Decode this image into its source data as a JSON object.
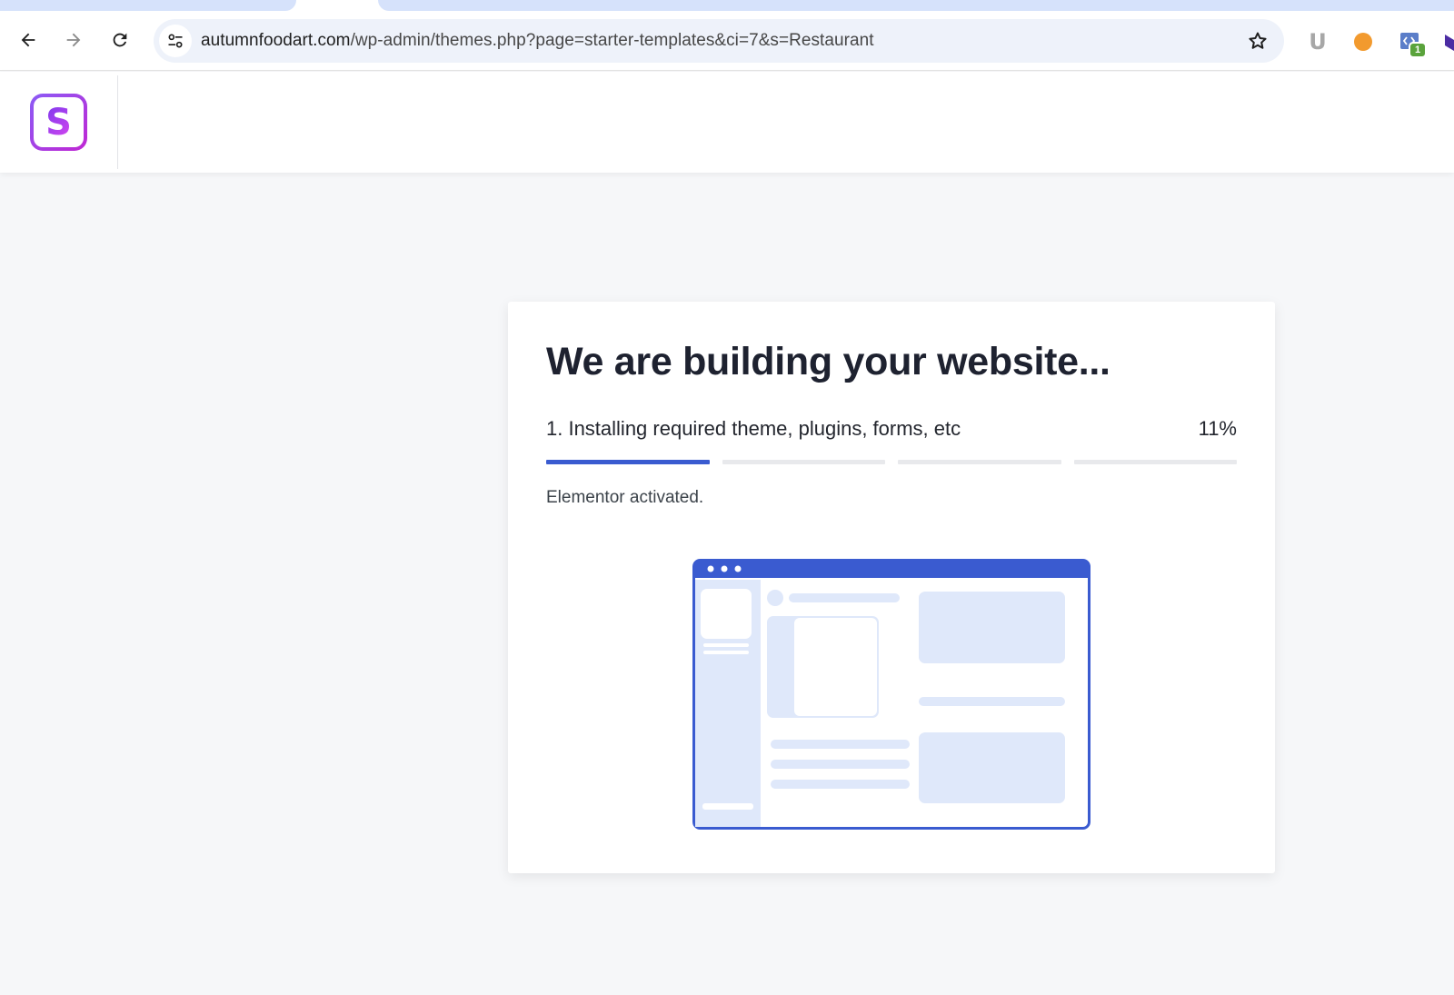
{
  "browser": {
    "url_domain": "autumnfoodart.com",
    "url_path": "/wp-admin/themes.php?page=starter-templates&ci=7&s=Restaurant",
    "extension_badge": "1",
    "extension_u_label": "U"
  },
  "header": {
    "logo_letter": "S"
  },
  "card": {
    "title": "We are building your website...",
    "step_label": "1. Installing required theme, plugins, forms, etc",
    "percent": "11%",
    "status": "Elementor activated.",
    "progress": {
      "segments": 4,
      "completed_segments": 1,
      "accent_color": "#3a5bd0"
    }
  },
  "colors": {
    "accent": "#3a5bd0",
    "illustration_light": "#dfe8fa",
    "logo_gradient": [
      "#7c3aed",
      "#d946ef"
    ]
  }
}
